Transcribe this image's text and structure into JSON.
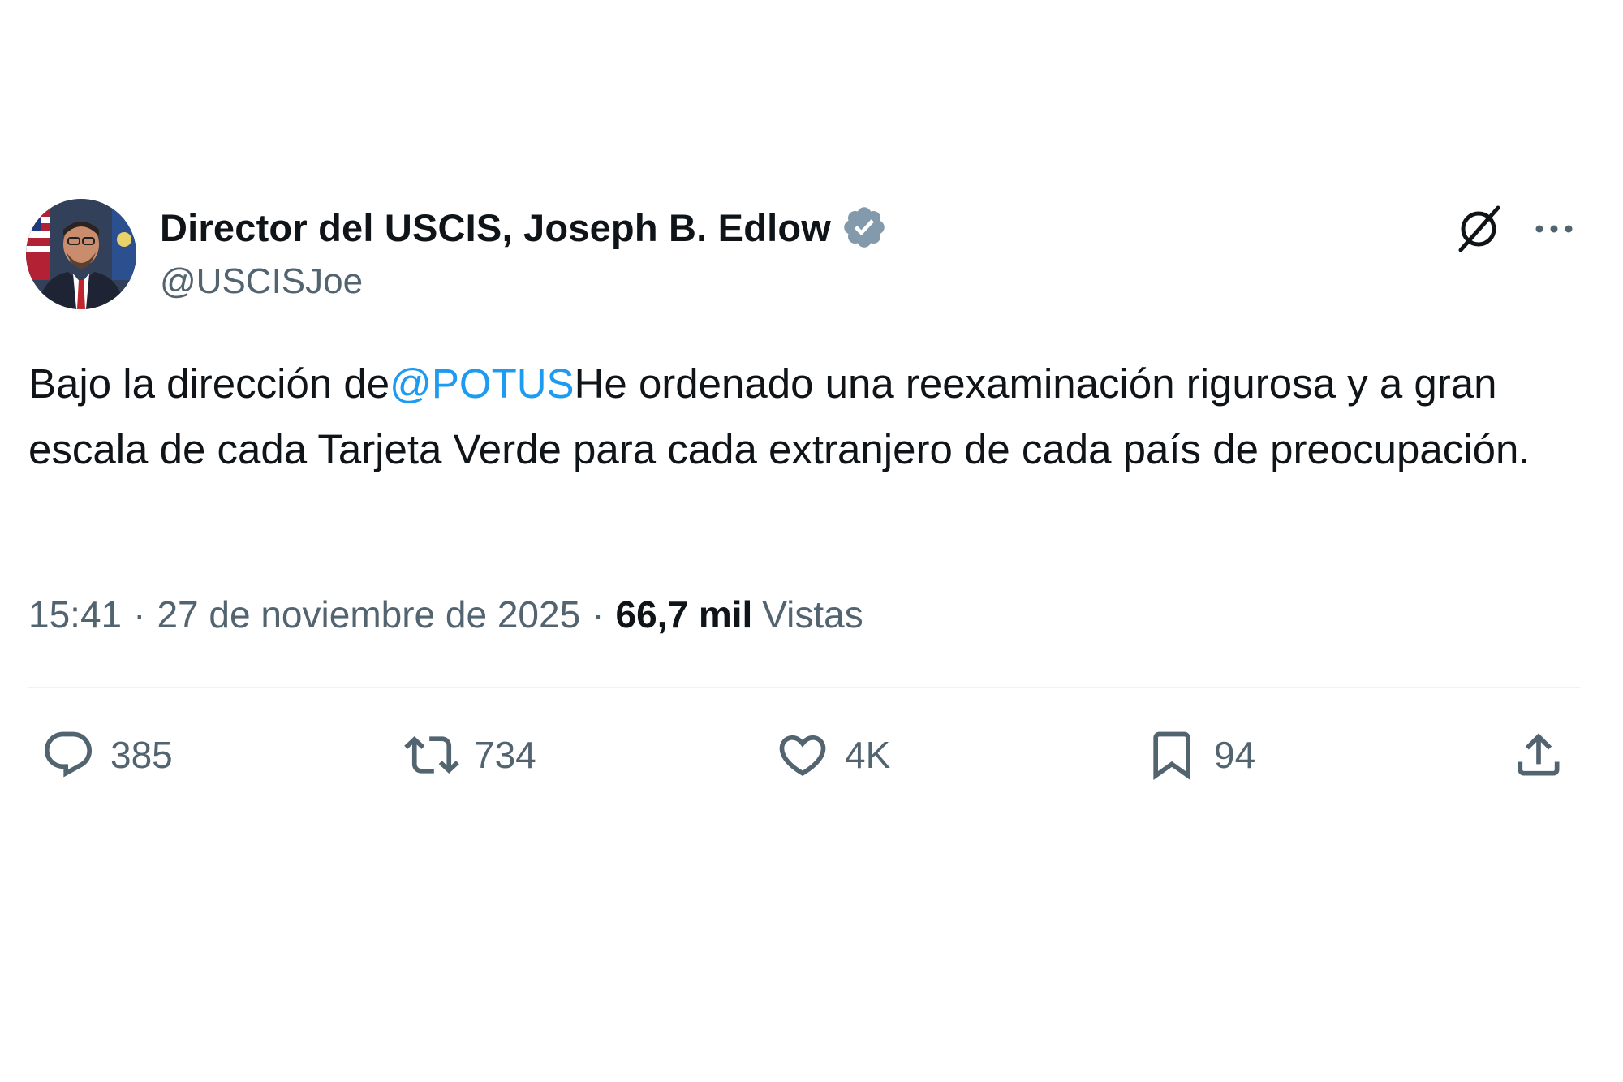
{
  "author": {
    "display_name": "Director del USCIS, Joseph B. Edlow",
    "handle": "@USCISJoe",
    "verified": true,
    "verified_color": "#829aab"
  },
  "header_icons": [
    "grok-icon",
    "more-icon"
  ],
  "tweet": {
    "text_before": "Bajo la dirección de",
    "mention": "@POTUS",
    "text_after": "He ordenado una reexaminación rigurosa y a gran escala de cada Tarjeta Verde para cada extranjero de cada país de preocupación."
  },
  "meta": {
    "time": "15:41",
    "date": "27 de noviembre de 2025",
    "separator": "·",
    "views_count": "66,7 mil",
    "views_label": "Vistas"
  },
  "actions": {
    "reply": {
      "icon": "reply-icon",
      "count": "385"
    },
    "repost": {
      "icon": "repost-icon",
      "count": "734"
    },
    "like": {
      "icon": "like-icon",
      "count": "4K"
    },
    "bookmark": {
      "icon": "bookmark-icon",
      "count": "94"
    },
    "share": {
      "icon": "share-icon"
    }
  },
  "colors": {
    "text": "#0f1419",
    "secondary": "#536471",
    "link": "#1d9bf0",
    "divider": "#eff3f4"
  }
}
